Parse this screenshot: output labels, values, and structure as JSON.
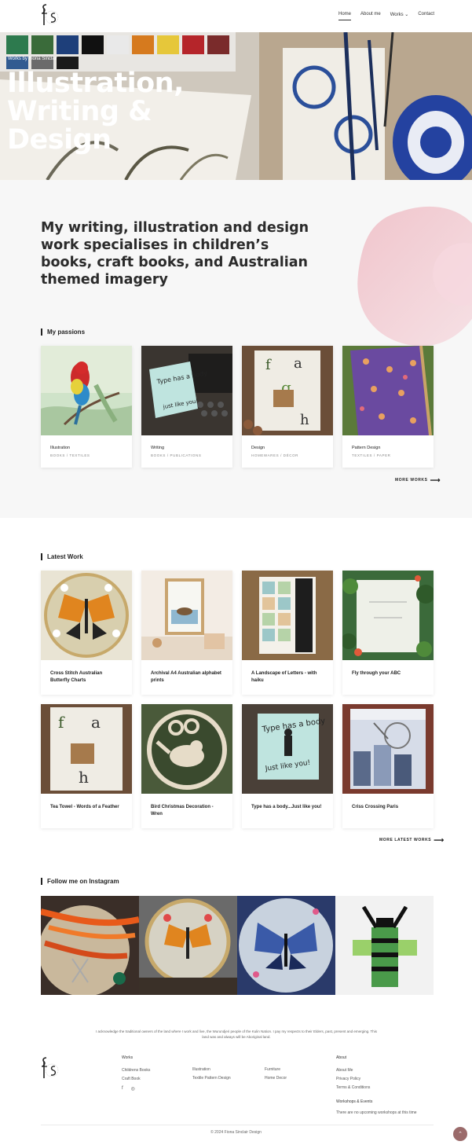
{
  "nav": {
    "home": "Home",
    "about": "About me",
    "works": "Works",
    "works_chevron": "⌄",
    "contact": "Contact"
  },
  "hero": {
    "kicker": "Works by Fiona Sinclair",
    "title_line1": "Illustration,",
    "title_line2": "Writing &",
    "title_line3": "Design"
  },
  "intro": {
    "statement": "My writing, illustration and design work specialises in children’s books, craft books, and Australian themed imagery"
  },
  "passions": {
    "label": "My passions",
    "cards": [
      {
        "title": "Illustration",
        "tags": "BOOKS / TEXTILES"
      },
      {
        "title": "Writing",
        "tags": "BOOKS / PUBLICATIONS"
      },
      {
        "title": "Design",
        "tags": "HOMEWARES / DÉCOR"
      },
      {
        "title": "Pattern Design",
        "tags": "TEXTILES / PAPER"
      }
    ],
    "more": "MORE WORKS",
    "more_arrow": "⟶"
  },
  "latest": {
    "label": "Latest Work",
    "cards": [
      {
        "title": "Cross Stitch Australian Butterfly Charts"
      },
      {
        "title": "Archival A4 Australian alphabet prints"
      },
      {
        "title": "A Landscape of Letters - with haiku"
      },
      {
        "title": "Fly through your ABC"
      },
      {
        "title": "Tea Towel - Words of a Feather"
      },
      {
        "title": "Bird Christmas Decoration - Wren"
      },
      {
        "title": "Type has a body...Just like you!"
      },
      {
        "title": "Criss Crossing Paris"
      }
    ],
    "more": "MORE LATEST WORKS",
    "more_arrow": "⟶"
  },
  "instagram": {
    "label": "Follow me on Instagram"
  },
  "acknowledgement": "I acknowledge the traditional owners of the land where I work and live, the Wurundjeri people of the Kulin Nation. I pay my respects to their Elders, past, present and emerging. This land was and always will be Aboriginal land.",
  "footer": {
    "works_heading": "Works",
    "works_col1": [
      "Childrens Books",
      "Craft Book"
    ],
    "works_col2": [
      "Illustration",
      "Textile Pattern Design"
    ],
    "works_col3": [
      "Furniture",
      "Home Decor"
    ],
    "about_heading": "About",
    "about_items": [
      "About Me",
      "Privacy Policy",
      "Terms & Conditions"
    ],
    "events_heading": "Workshops & Events",
    "events_text": "There are no upcoming workshops at this time",
    "social_facebook": "f",
    "social_instagram": "◎",
    "copyright": "© 2024 Fiona Sinclair Design",
    "to_top": "⌃"
  },
  "colors": {
    "accent": "#e8b9c2",
    "text": "#222222",
    "bg_light": "#f7f7f7",
    "to_top": "#9b6b6b"
  },
  "icons": [
    "fs-logo",
    "chevron-down-icon",
    "arrow-right-icon",
    "facebook-icon",
    "instagram-icon",
    "arrow-up-icon"
  ]
}
